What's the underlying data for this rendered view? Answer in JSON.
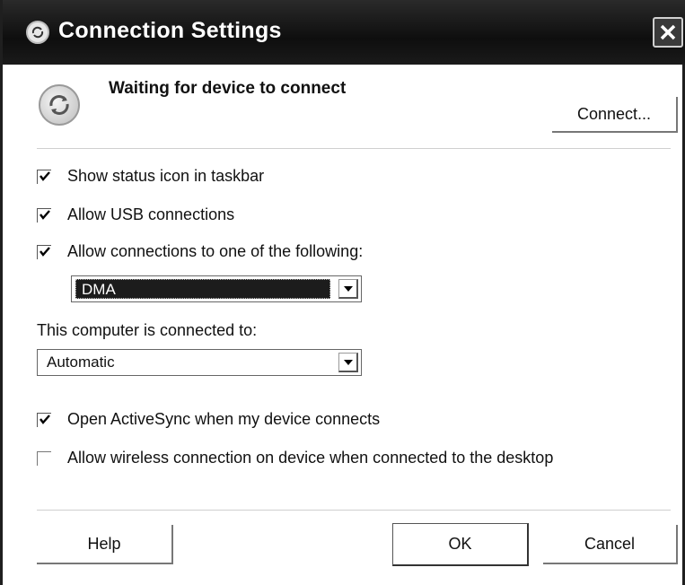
{
  "window": {
    "title": "Connection Settings"
  },
  "status": {
    "text": "Waiting for device to connect",
    "connect_button": "Connect..."
  },
  "options": [
    {
      "label": "Show status icon in taskbar",
      "checked": true
    },
    {
      "label": "Allow USB connections",
      "checked": true
    },
    {
      "label": "Allow connections to one of the following:",
      "checked": true
    }
  ],
  "port_select": {
    "value": "DMA"
  },
  "connected_to": {
    "label": "This computer is connected to:",
    "value": "Automatic"
  },
  "bottom_options": [
    {
      "label": "Open ActiveSync when my device connects",
      "checked": true
    },
    {
      "label": "Allow wireless connection on device when connected to the desktop",
      "checked": false
    }
  ],
  "footer": {
    "help": "Help",
    "ok": "OK",
    "cancel": "Cancel"
  },
  "icons": {
    "title": "activesync-icon",
    "close": "close-icon",
    "device": "activesync-device-icon",
    "dropdown": "chevron-down-icon"
  }
}
